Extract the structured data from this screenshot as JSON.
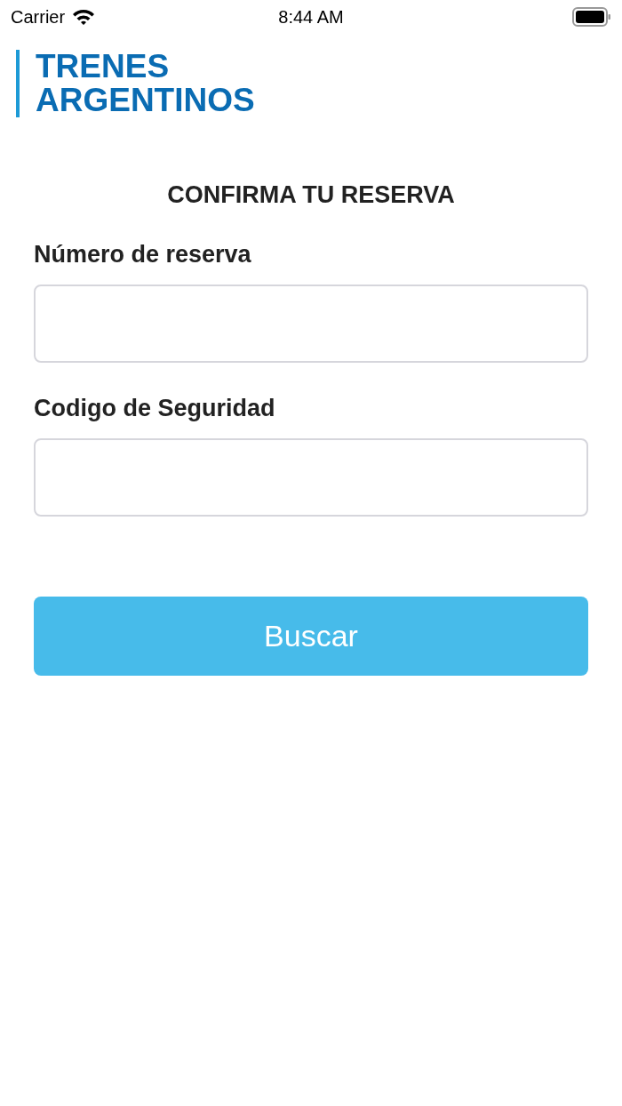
{
  "status_bar": {
    "carrier": "Carrier",
    "time": "8:44 AM"
  },
  "logo": {
    "lines": [
      "TRENES",
      "ARGENTINOS"
    ]
  },
  "title": "CONFIRMA TU RESERVA",
  "fields": [
    {
      "label": "Número de reserva"
    },
    {
      "label": "Codigo de Seguridad"
    }
  ],
  "button": "Buscar"
}
